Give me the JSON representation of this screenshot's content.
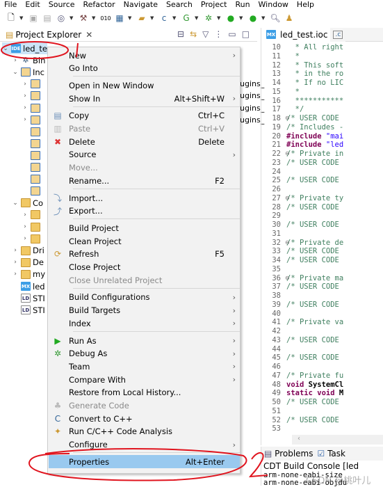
{
  "menubar": [
    "File",
    "Edit",
    "Source",
    "Refactor",
    "Navigate",
    "Search",
    "Project",
    "Run",
    "Window",
    "Help"
  ],
  "explorer": {
    "title": "Project Explorer",
    "close": "✕"
  },
  "tree": [
    {
      "label": "led_te",
      "indent": 0,
      "tw": "v",
      "icon": "ide",
      "selected": true
    },
    {
      "label": "Bin",
      "indent": 1,
      "tw": ">",
      "icon": "bin"
    },
    {
      "label": "Inc",
      "indent": 1,
      "tw": "v",
      "icon": "inc"
    },
    {
      "label": "",
      "indent": 2,
      "tw": ">",
      "icon": "inc",
      "side": "ugins_"
    },
    {
      "label": "",
      "indent": 2,
      "tw": ">",
      "icon": "inc",
      "side": "ugins_"
    },
    {
      "label": "",
      "indent": 2,
      "tw": ">",
      "icon": "inc",
      "side": "ugins_"
    },
    {
      "label": "",
      "indent": 2,
      "tw": ">",
      "icon": "inc",
      "side": "ugins_"
    },
    {
      "label": "",
      "indent": 2,
      "tw": "",
      "icon": "inc"
    },
    {
      "label": "",
      "indent": 2,
      "tw": "",
      "icon": "inc"
    },
    {
      "label": "",
      "indent": 2,
      "tw": "",
      "icon": "inc"
    },
    {
      "label": "",
      "indent": 2,
      "tw": "",
      "icon": "inc"
    },
    {
      "label": "",
      "indent": 2,
      "tw": "",
      "icon": "inc"
    },
    {
      "label": "",
      "indent": 2,
      "tw": "",
      "icon": "inc"
    },
    {
      "label": "Co",
      "indent": 1,
      "tw": "v",
      "icon": "fold"
    },
    {
      "label": "",
      "indent": 2,
      "tw": ">",
      "icon": "fold"
    },
    {
      "label": "",
      "indent": 2,
      "tw": ">",
      "icon": "fold"
    },
    {
      "label": "",
      "indent": 2,
      "tw": ">",
      "icon": "fold"
    },
    {
      "label": "Dri",
      "indent": 1,
      "tw": ">",
      "icon": "fold"
    },
    {
      "label": "De",
      "indent": 1,
      "tw": ">",
      "icon": "fold"
    },
    {
      "label": "my",
      "indent": 1,
      "tw": ">",
      "icon": "fold"
    },
    {
      "label": "led",
      "indent": 1,
      "tw": "",
      "icon": "mx"
    },
    {
      "label": "STI",
      "indent": 1,
      "tw": "",
      "icon": "ld"
    },
    {
      "label": "STI",
      "indent": 1,
      "tw": "",
      "icon": "ld"
    }
  ],
  "icon_text": {
    "ide": "IDE",
    "mx": "MX",
    "ld": "LD"
  },
  "editor": {
    "tabs": [
      "led_test.ioc"
    ],
    "lines": [
      {
        "n": "10",
        "t": "  * All right",
        "c": "cm"
      },
      {
        "n": "11",
        "t": "  *",
        "c": "cm"
      },
      {
        "n": "12",
        "t": "  * This soft",
        "c": "cm"
      },
      {
        "n": "13",
        "t": "  * in the ro",
        "c": "cm"
      },
      {
        "n": "14",
        "t": "  * If no LIC",
        "c": "cm"
      },
      {
        "n": "15",
        "t": "  *",
        "c": "cm"
      },
      {
        "n": "16",
        "t": "  ***********",
        "c": "cm"
      },
      {
        "n": "17",
        "t": "  */",
        "c": "cm"
      },
      {
        "n": "18",
        "t": "/* USER CODE",
        "c": "cm",
        "f": true
      },
      {
        "n": "19",
        "t": "/* Includes -",
        "c": "cm"
      },
      {
        "n": "20",
        "k": "#include",
        "t": " \"mai",
        "c": "st"
      },
      {
        "n": "21",
        "k": "#include",
        "t": " \"led",
        "c": "st"
      },
      {
        "n": "22",
        "t": "/* Private in",
        "c": "cm",
        "f": true
      },
      {
        "n": "23",
        "t": "/* USER CODE",
        "c": "cm"
      },
      {
        "n": "24",
        "t": "",
        "c": "cm"
      },
      {
        "n": "25",
        "t": "/* USER CODE",
        "c": "cm"
      },
      {
        "n": "26",
        "t": "",
        "c": "cm"
      },
      {
        "n": "27",
        "t": "/* Private ty",
        "c": "cm",
        "f": true
      },
      {
        "n": "28",
        "t": "/* USER CODE",
        "c": "cm"
      },
      {
        "n": "29",
        "t": "",
        "c": "cm"
      },
      {
        "n": "30",
        "t": "/* USER CODE",
        "c": "cm"
      },
      {
        "n": "31",
        "t": "",
        "c": "cm"
      },
      {
        "n": "32",
        "t": "/* Private de",
        "c": "cm",
        "f": true
      },
      {
        "n": "33",
        "t": "/* USER CODE",
        "c": "cm"
      },
      {
        "n": "34",
        "t": "/* USER CODE",
        "c": "cm"
      },
      {
        "n": "35",
        "t": "",
        "c": "cm"
      },
      {
        "n": "36",
        "t": "/* Private ma",
        "c": "cm",
        "f": true
      },
      {
        "n": "37",
        "t": "/* USER CODE",
        "c": "cm"
      },
      {
        "n": "38",
        "t": "",
        "c": "cm"
      },
      {
        "n": "39",
        "t": "/* USER CODE",
        "c": "cm"
      },
      {
        "n": "40",
        "t": "",
        "c": "cm"
      },
      {
        "n": "41",
        "t": "/* Private va",
        "c": "cm"
      },
      {
        "n": "42",
        "t": "",
        "c": "cm"
      },
      {
        "n": "43",
        "t": "/* USER CODE",
        "c": "cm"
      },
      {
        "n": "44",
        "t": "",
        "c": "cm"
      },
      {
        "n": "45",
        "t": "/* USER CODE",
        "c": "cm"
      },
      {
        "n": "46",
        "t": "",
        "c": "cm"
      },
      {
        "n": "47",
        "t": "/* Private fu",
        "c": "cm"
      },
      {
        "n": "48",
        "k": "void",
        "t": " SystemCl",
        "c": "df"
      },
      {
        "n": "49",
        "k": "static void",
        "t": " M",
        "c": "df"
      },
      {
        "n": "50",
        "t": "/* USER CODE",
        "c": "cm"
      },
      {
        "n": "51",
        "t": "",
        "c": "cm"
      },
      {
        "n": "52",
        "t": "/* USER CODE",
        "c": "cm"
      },
      {
        "n": "53",
        "t": "",
        "c": "cm"
      }
    ]
  },
  "bottom": {
    "tabs": [
      "Problems",
      "Task"
    ],
    "console_title": "CDT Build Console [led",
    "lines": [
      "arm-none-eabi-size",
      "arm-none-eabi-objdu"
    ]
  },
  "menu": [
    {
      "label": "New",
      "arrow": true
    },
    {
      "label": "Go Into"
    },
    {
      "sep": true
    },
    {
      "label": "Open in New Window"
    },
    {
      "label": "Show In",
      "shortcut": "Alt+Shift+W",
      "arrow": true
    },
    {
      "sep": true
    },
    {
      "label": "Copy",
      "shortcut": "Ctrl+C",
      "icon": "copy"
    },
    {
      "label": "Paste",
      "shortcut": "Ctrl+V",
      "icon": "paste",
      "disabled": true
    },
    {
      "label": "Delete",
      "shortcut": "Delete",
      "icon": "delete"
    },
    {
      "label": "Source",
      "arrow": true
    },
    {
      "label": "Move...",
      "disabled": true
    },
    {
      "label": "Rename...",
      "shortcut": "F2"
    },
    {
      "sep": true
    },
    {
      "label": "Import...",
      "icon": "import"
    },
    {
      "label": "Export...",
      "icon": "export"
    },
    {
      "sep": true
    },
    {
      "label": "Build Project"
    },
    {
      "label": "Clean Project"
    },
    {
      "label": "Refresh",
      "shortcut": "F5",
      "icon": "refresh"
    },
    {
      "label": "Close Project"
    },
    {
      "label": "Close Unrelated Project",
      "disabled": true
    },
    {
      "sep": true
    },
    {
      "label": "Build Configurations",
      "arrow": true
    },
    {
      "label": "Build Targets",
      "arrow": true
    },
    {
      "label": "Index",
      "arrow": true
    },
    {
      "sep": true
    },
    {
      "label": "Run As",
      "arrow": true,
      "icon": "run"
    },
    {
      "label": "Debug As",
      "arrow": true,
      "icon": "debug"
    },
    {
      "label": "Team",
      "arrow": true
    },
    {
      "label": "Compare With",
      "arrow": true
    },
    {
      "label": "Restore from Local History..."
    },
    {
      "label": "Generate Code",
      "disabled": true,
      "icon": "generate"
    },
    {
      "label": "Convert to C++",
      "icon": "convert"
    },
    {
      "label": "Run C/C++ Code Analysis",
      "icon": "analysis"
    },
    {
      "label": "Configure",
      "arrow": true
    },
    {
      "sep": true
    },
    {
      "label": "Properties",
      "shortcut": "Alt+Enter",
      "selected": true
    }
  ],
  "annotations": [
    "1",
    "2"
  ],
  "watermark": "CSDN @桃叶儿",
  "colors": {
    "selection": "#99c9ef",
    "annotation": "#e0141e",
    "comment": "#3f7f5f",
    "keyword": "#7f0055"
  }
}
